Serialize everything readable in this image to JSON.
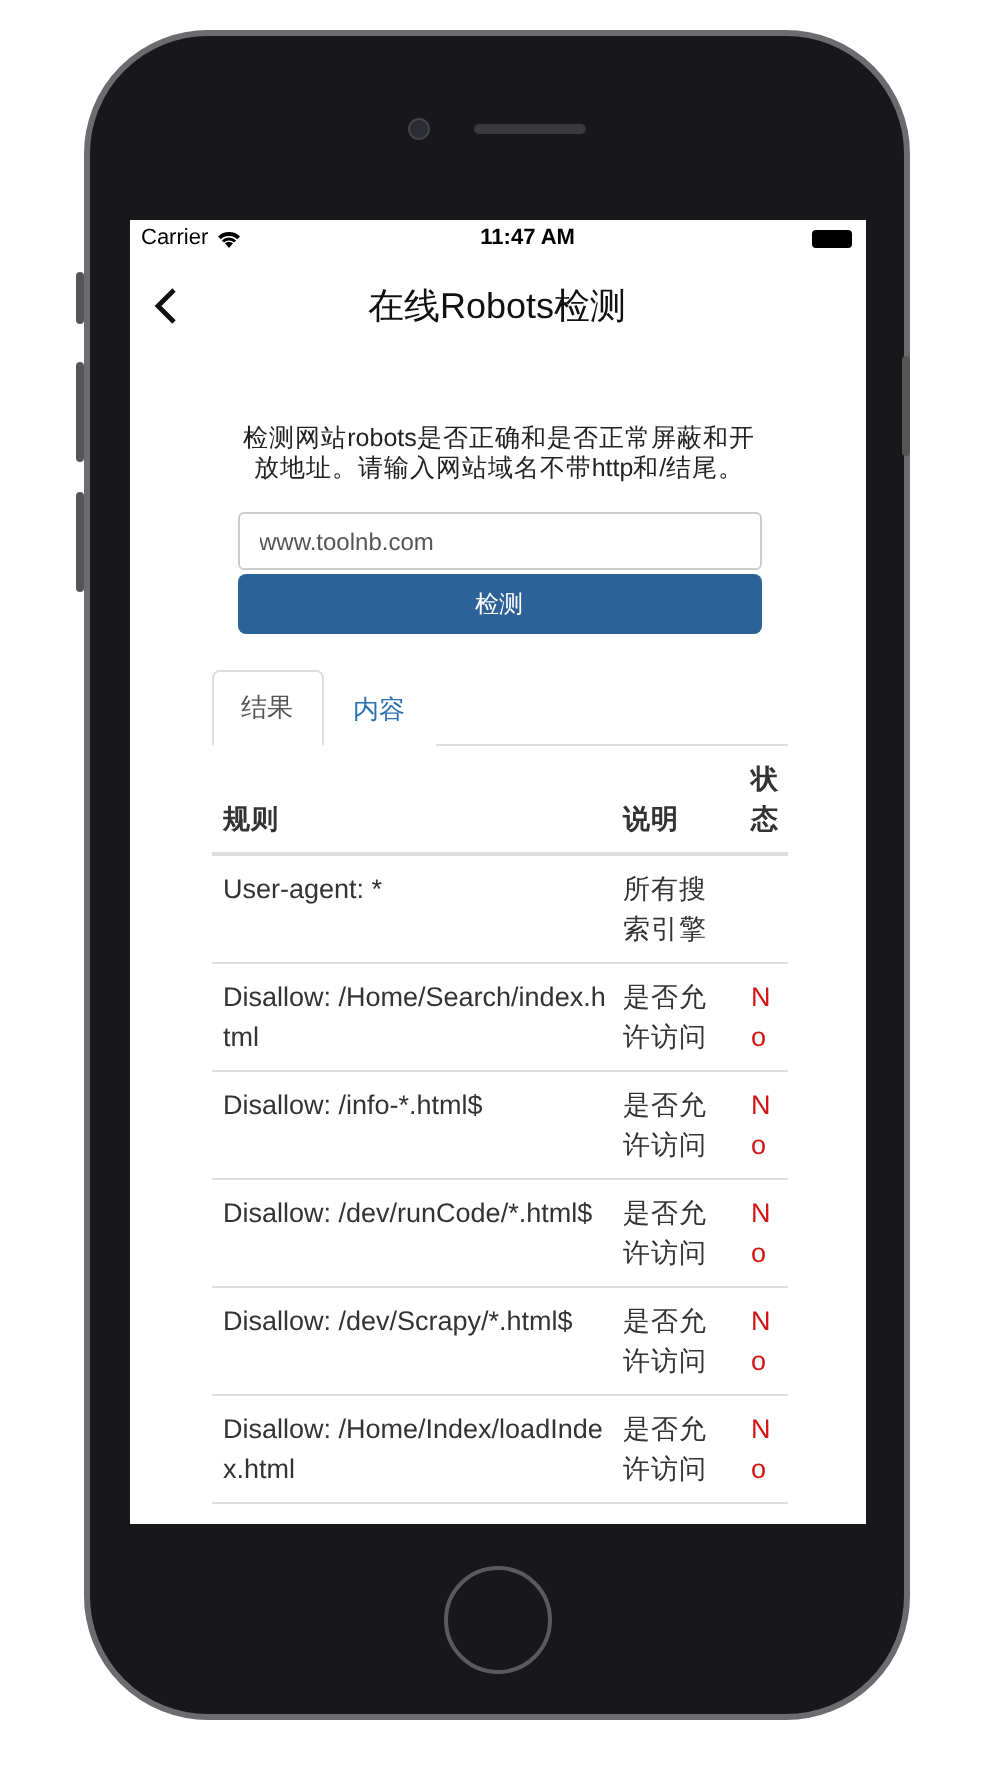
{
  "status_bar": {
    "carrier": "Carrier",
    "time": "11:47 AM"
  },
  "nav": {
    "title": "在线Robots检测"
  },
  "intro": "检测网站robots是否正确和是否正常屏蔽和开放地址。请输入网站域名不带http和/结尾。",
  "search": {
    "placeholder": "www.toolnb.com",
    "button": "检测"
  },
  "tabs": [
    {
      "label": "结果",
      "selected": true
    },
    {
      "label": "内容",
      "selected": false
    }
  ],
  "table": {
    "columns": [
      "规则",
      "说明",
      "状态"
    ],
    "rows": [
      {
        "rule": "User-agent: *",
        "note": "所有搜索引擎",
        "status": ""
      },
      {
        "rule": "Disallow: /Home/Search/index.html",
        "note": "是否允许访问",
        "status": "No"
      },
      {
        "rule": "Disallow: /info-*.html$",
        "note": "是否允许访问",
        "status": "No"
      },
      {
        "rule": "Disallow: /dev/runCode/*.html$",
        "note": "是否允许访问",
        "status": "No"
      },
      {
        "rule": "Disallow: /dev/Scrapy/*.html$",
        "note": "是否允许访问",
        "status": "No"
      },
      {
        "rule": "Disallow: /Home/Index/loadIndex.html",
        "note": "是否允许访问",
        "status": "No"
      }
    ]
  }
}
